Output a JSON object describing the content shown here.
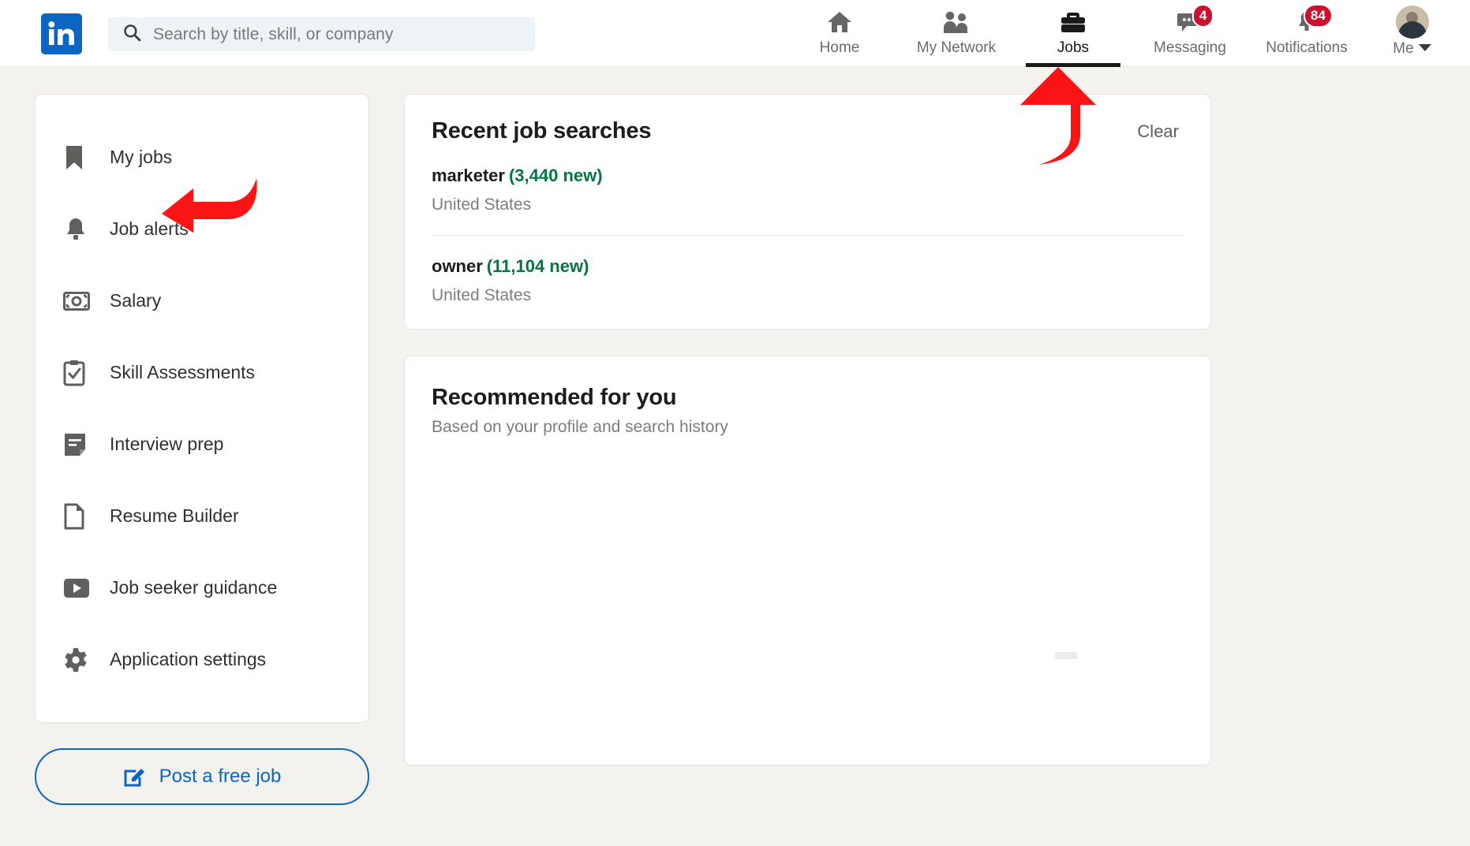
{
  "brand": {
    "logo_text": "in",
    "logo_color": "#0a66c2",
    "accent_green": "#057642",
    "badge_red": "#cb112d",
    "annotation_red": "#fa1414",
    "page_background": "#f3f2ef"
  },
  "search": {
    "placeholder": "Search by title, skill, or company",
    "value": "",
    "icon": "search-icon"
  },
  "nav": {
    "items": [
      {
        "label": "Home",
        "icon": "home-icon",
        "active": false,
        "badge": null
      },
      {
        "label": "My Network",
        "icon": "people-icon",
        "active": false,
        "badge": null
      },
      {
        "label": "Jobs",
        "icon": "briefcase-icon",
        "active": true,
        "badge": null
      },
      {
        "label": "Messaging",
        "icon": "message-bubble-icon",
        "active": false,
        "badge": "4"
      },
      {
        "label": "Notifications",
        "icon": "bell-icon",
        "active": false,
        "badge": "84"
      }
    ],
    "me": {
      "label": "Me",
      "icon": "chevron-down-icon",
      "avatar": "avatar"
    }
  },
  "sidebar": {
    "items": [
      {
        "label": "My jobs",
        "icon": "bookmark-icon"
      },
      {
        "label": "Job alerts",
        "icon": "bell-icon"
      },
      {
        "label": "Salary",
        "icon": "banknote-icon"
      },
      {
        "label": "Skill Assessments",
        "icon": "clipboard-check-icon"
      },
      {
        "label": "Interview prep",
        "icon": "notes-icon"
      },
      {
        "label": "Resume Builder",
        "icon": "document-icon"
      },
      {
        "label": "Job seeker guidance",
        "icon": "play-video-icon"
      },
      {
        "label": "Application settings",
        "icon": "gear-icon"
      }
    ],
    "post_job": {
      "label": "Post a free job",
      "icon": "compose-pencil-icon"
    }
  },
  "main": {
    "recent_searches": {
      "title": "Recent job searches",
      "clear_label": "Clear",
      "rows": [
        {
          "term": "marketer",
          "new_count": "(3,440 new)",
          "location": "United States"
        },
        {
          "term": "owner",
          "new_count": "(11,104 new)",
          "location": "United States"
        }
      ]
    },
    "recommended": {
      "title": "Recommended for you",
      "subtitle": "Based on your profile and search history"
    }
  },
  "annotations": [
    {
      "name": "arrow-pointing-to-my-jobs",
      "direction": "left",
      "target": "My jobs"
    },
    {
      "name": "arrow-pointing-to-jobs-tab",
      "direction": "up",
      "target": "Jobs"
    }
  ]
}
